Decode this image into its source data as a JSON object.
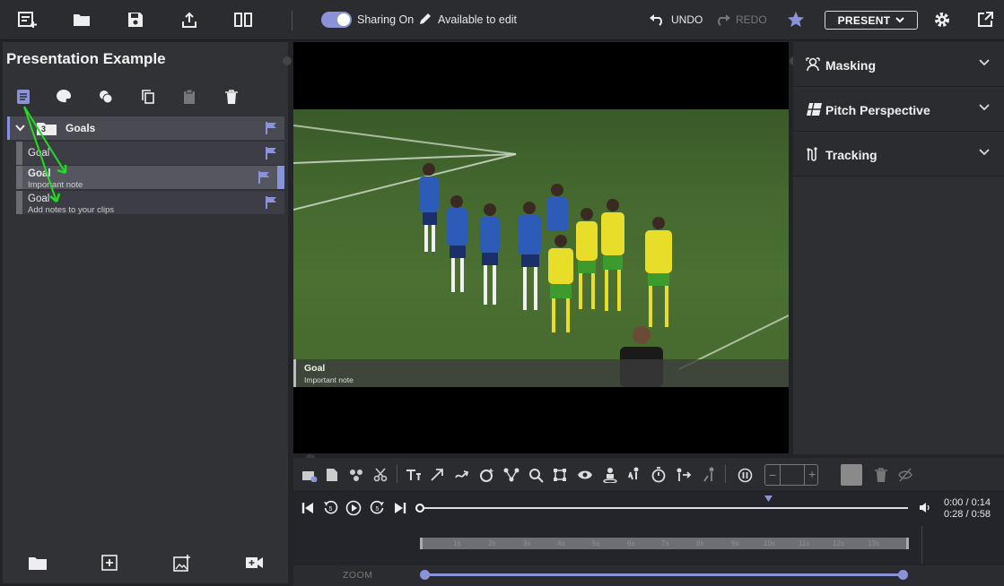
{
  "toolbar": {
    "sharing_label": "Sharing On",
    "edit_label": "Available to edit",
    "undo_label": "UNDO",
    "redo_label": "REDO",
    "present_label": "PRESENT"
  },
  "left_panel": {
    "title": "Presentation Example",
    "folder": {
      "name": "Goals",
      "count": "3"
    },
    "clips": [
      {
        "title": "Goal",
        "note": ""
      },
      {
        "title": "Goal",
        "note": "Important note"
      },
      {
        "title": "Goal",
        "note": "Add notes to your clips"
      }
    ]
  },
  "video": {
    "caption_title": "Goal",
    "caption_note": "Important note"
  },
  "right_panel": {
    "sections": [
      "Masking",
      "Pitch Perspective",
      "Tracking"
    ]
  },
  "transport": {
    "time_current": "0:00 / 0:14",
    "time_total": "0:28 / 0:58"
  },
  "timeline": {
    "ticks": [
      "1s",
      "2s",
      "3s",
      "4s",
      "5s",
      "6s",
      "7s",
      "8s",
      "9s",
      "10s",
      "11s",
      "12s",
      "13s"
    ]
  },
  "zoom": {
    "label": "ZOOM"
  },
  "colors": {
    "accent": "#8b93d8",
    "background": "#232427",
    "panel": "#313236"
  }
}
